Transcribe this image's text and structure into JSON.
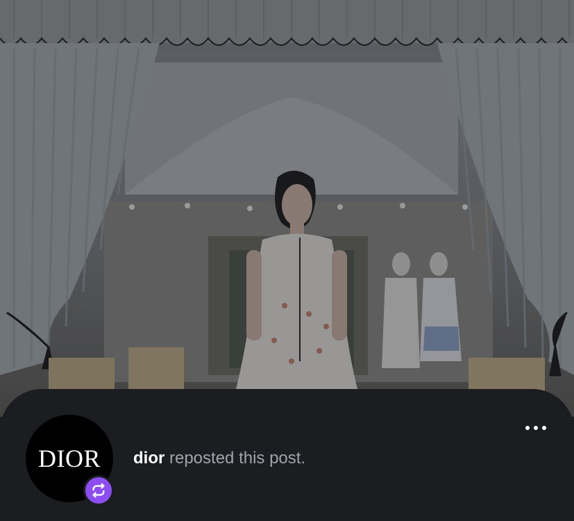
{
  "post": {
    "image_description": "Woman in white sleeveless dress standing in a boutique framed by striped curtains",
    "repost": {
      "username": "dior",
      "action_text": " reposted this post."
    },
    "avatar": {
      "logo_text": "DIOR",
      "badge_icon": "repost-icon",
      "badge_color": "#8c4ef0"
    },
    "more_icon": "more-horizontal-icon"
  }
}
